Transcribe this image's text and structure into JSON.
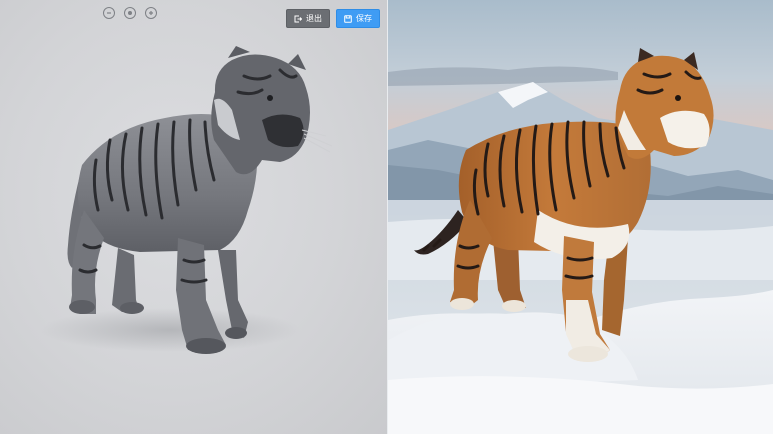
{
  "toolbar": {
    "exit_label": "退出",
    "save_label": "保存"
  },
  "view_controls": [
    "zoom-out-icon",
    "reset-view-icon",
    "zoom-in-icon"
  ],
  "colors": {
    "save_button": "#3f9cf4",
    "exit_button": "#6b6e73",
    "viewer_background": "#d3d4d7"
  }
}
